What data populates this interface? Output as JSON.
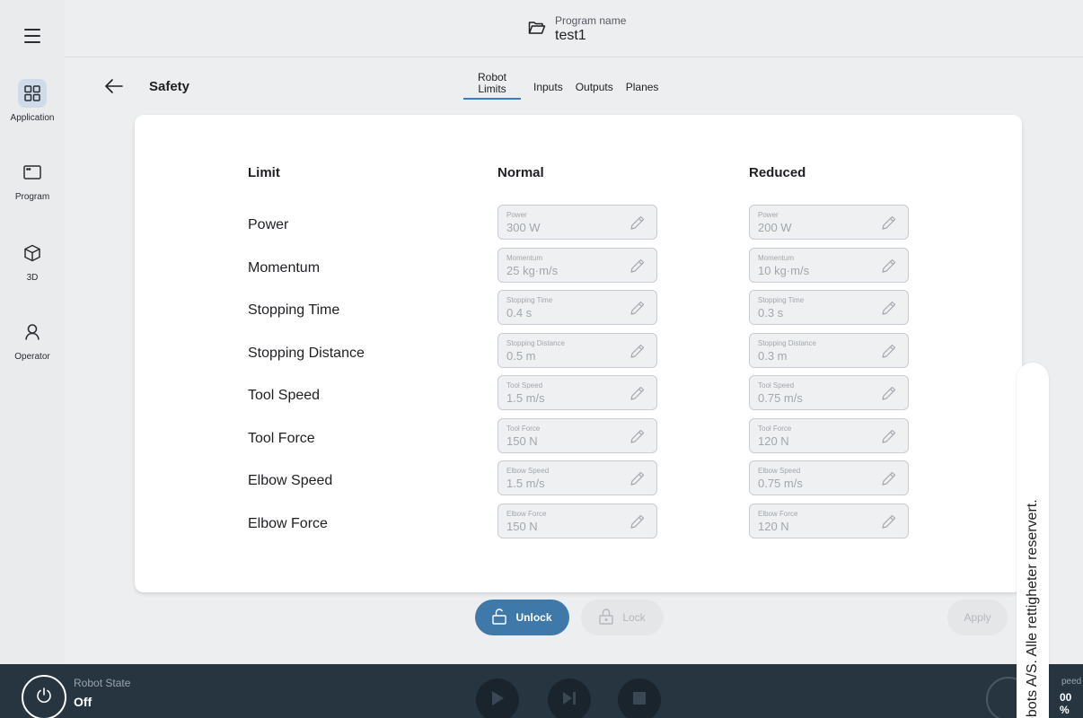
{
  "rail": {
    "items": [
      {
        "label": "Application",
        "icon": "grid-icon",
        "active": true
      },
      {
        "label": "Program",
        "icon": "window-icon",
        "active": false
      },
      {
        "label": "3D",
        "icon": "cube-icon",
        "active": false
      },
      {
        "label": "Operator",
        "icon": "person-icon",
        "active": false
      }
    ]
  },
  "topbar": {
    "program_label": "Program name",
    "program_value": "test1"
  },
  "header": {
    "title": "Safety",
    "tabs": [
      {
        "label": "Robot Limits",
        "active": true
      },
      {
        "label": "Inputs",
        "active": false
      },
      {
        "label": "Outputs",
        "active": false
      },
      {
        "label": "Planes",
        "active": false
      }
    ]
  },
  "table": {
    "col_limit": "Limit",
    "col_normal": "Normal",
    "col_reduced": "Reduced",
    "rows": [
      {
        "label": "Power",
        "field": "Power",
        "normal": "300 W",
        "reduced": "200 W"
      },
      {
        "label": "Momentum",
        "field": "Momentum",
        "normal": "25 kg·m/s",
        "reduced": "10 kg·m/s"
      },
      {
        "label": "Stopping Time",
        "field": "Stopping Time",
        "normal": "0.4 s",
        "reduced": "0.3 s"
      },
      {
        "label": "Stopping Distance",
        "field": "Stopping Distance",
        "normal": "0.5 m",
        "reduced": "0.3 m"
      },
      {
        "label": "Tool Speed",
        "field": "Tool Speed",
        "normal": "1.5 m/s",
        "reduced": "0.75 m/s"
      },
      {
        "label": "Tool Force",
        "field": "Tool Force",
        "normal": "150 N",
        "reduced": "120 N"
      },
      {
        "label": "Elbow Speed",
        "field": "Elbow Speed",
        "normal": "1.5 m/s",
        "reduced": "0.75 m/s"
      },
      {
        "label": "Elbow Force",
        "field": "Elbow Force",
        "normal": "150 N",
        "reduced": "120 N"
      }
    ]
  },
  "actions": {
    "unlock": "Unlock",
    "lock": "Lock",
    "apply": "Apply"
  },
  "bottombar": {
    "robot_state_label": "Robot State",
    "robot_state_value": "Off",
    "speed_label": "peed",
    "speed_value": "00 %"
  },
  "watermark": "obots A/S. Alle rettigheter reservert.",
  "colors": {
    "accent": "#3b7cc4",
    "unlock_bg": "#3f79a9",
    "bottombar_bg": "#273541"
  }
}
